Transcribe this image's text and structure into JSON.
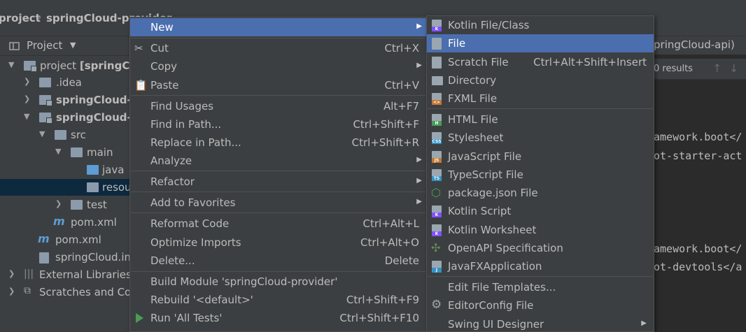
{
  "breadcrumb": {
    "items": [
      "project",
      "springCloud-provider"
    ]
  },
  "project_panel": {
    "title": "Project",
    "tree": [
      {
        "label": "project [springCloud",
        "bold_part": "[springCloud",
        "plain_part": "project "
      },
      {
        "label": ".idea"
      },
      {
        "label": "springCloud-api"
      },
      {
        "label": "springCloud-provider"
      },
      {
        "label": "src"
      },
      {
        "label": "main"
      },
      {
        "label": "java"
      },
      {
        "label": "resources"
      },
      {
        "label": "test"
      },
      {
        "label": "pom.xml"
      },
      {
        "label": "pom.xml"
      },
      {
        "label": "springCloud.iml"
      },
      {
        "label": "External Libraries"
      },
      {
        "label": "Scratches and Consoles"
      }
    ]
  },
  "editor": {
    "tab_label": "pringCloud-api)",
    "search_results": "0 results",
    "code_lines": [
      "amework.boot</",
      "ot-starter-act",
      "amework.boot</",
      "ot-devtools</a"
    ]
  },
  "context_menu": {
    "items": [
      {
        "label": "New",
        "shortcut": "",
        "submenu": true
      },
      {
        "label": "Cut",
        "shortcut": "Ctrl+X"
      },
      {
        "label": "Copy",
        "shortcut": "",
        "submenu": true
      },
      {
        "label": "Paste",
        "shortcut": "Ctrl+V"
      },
      {
        "label": "Find Usages",
        "shortcut": "Alt+F7"
      },
      {
        "label": "Find in Path...",
        "shortcut": "Ctrl+Shift+F"
      },
      {
        "label": "Replace in Path...",
        "shortcut": "Ctrl+Shift+R"
      },
      {
        "label": "Analyze",
        "shortcut": "",
        "submenu": true
      },
      {
        "label": "Refactor",
        "shortcut": "",
        "submenu": true
      },
      {
        "label": "Add to Favorites",
        "shortcut": "",
        "submenu": true
      },
      {
        "label": "Reformat Code",
        "shortcut": "Ctrl+Alt+L"
      },
      {
        "label": "Optimize Imports",
        "shortcut": "Ctrl+Alt+O"
      },
      {
        "label": "Delete...",
        "shortcut": "Delete"
      },
      {
        "label": "Build Module 'springCloud-provider'",
        "shortcut": ""
      },
      {
        "label": "Rebuild '<default>'",
        "shortcut": "Ctrl+Shift+F9"
      },
      {
        "label": "Run 'All Tests'",
        "shortcut": "Ctrl+Shift+F10"
      }
    ]
  },
  "new_submenu": {
    "items": [
      {
        "label": "Kotlin File/Class",
        "shortcut": ""
      },
      {
        "label": "File",
        "shortcut": ""
      },
      {
        "label": "Scratch File",
        "shortcut": "Ctrl+Alt+Shift+Insert"
      },
      {
        "label": "Directory",
        "shortcut": ""
      },
      {
        "label": "FXML File",
        "shortcut": ""
      },
      {
        "label": "HTML File",
        "shortcut": ""
      },
      {
        "label": "Stylesheet",
        "shortcut": ""
      },
      {
        "label": "JavaScript File",
        "shortcut": ""
      },
      {
        "label": "TypeScript File",
        "shortcut": ""
      },
      {
        "label": "package.json File",
        "shortcut": ""
      },
      {
        "label": "Kotlin Script",
        "shortcut": ""
      },
      {
        "label": "Kotlin Worksheet",
        "shortcut": ""
      },
      {
        "label": "OpenAPI Specification",
        "shortcut": ""
      },
      {
        "label": "JavaFXApplication",
        "shortcut": ""
      },
      {
        "label": "Edit File Templates...",
        "shortcut": ""
      },
      {
        "label": "EditorConfig File",
        "shortcut": ""
      },
      {
        "label": "Swing UI Designer",
        "shortcut": "",
        "submenu": true
      }
    ]
  },
  "icons": {
    "cut": "scissors-icon",
    "paste": "clipboard-icon",
    "run": "run-icon",
    "kotlin": "kotlin-file-icon",
    "file": "file-icon",
    "directory": "folder-icon",
    "settings": "gear-icon"
  },
  "colors": {
    "menu_bg": "#3c3f41",
    "highlight": "#4b6eaf",
    "editor_bg": "#2b2b2b",
    "selection": "#0d293e"
  }
}
